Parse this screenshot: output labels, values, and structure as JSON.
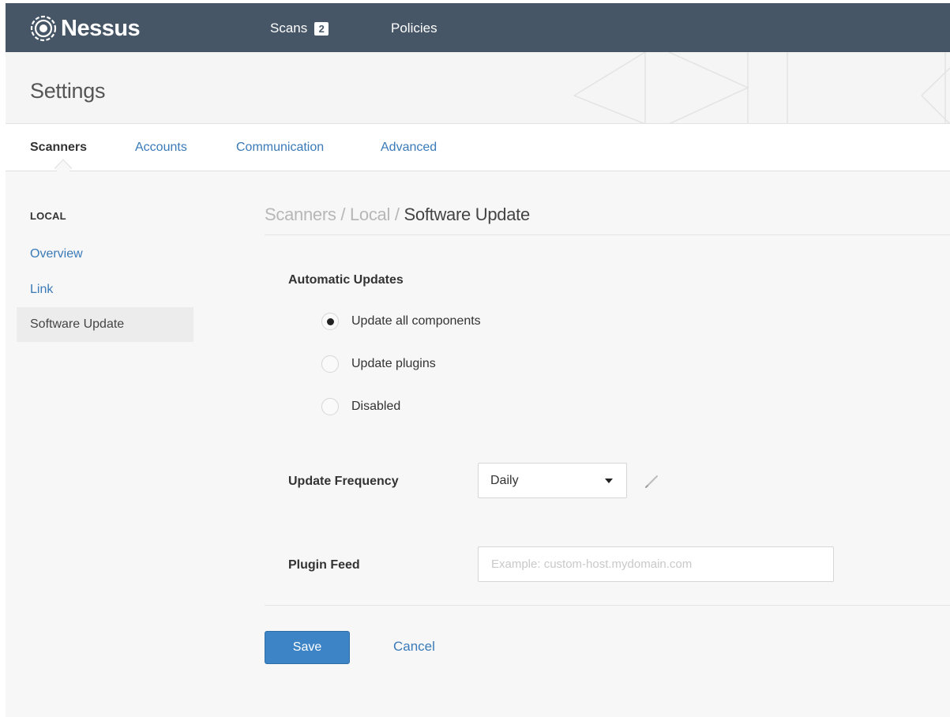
{
  "app": {
    "name": "Nessus",
    "logo_icon": "nessus-logo-icon"
  },
  "nav": {
    "scans_label": "Scans",
    "scans_count": "2",
    "policies_label": "Policies"
  },
  "page": {
    "title": "Settings"
  },
  "tabs": [
    {
      "label": "Scanners",
      "active": true
    },
    {
      "label": "Accounts",
      "active": false
    },
    {
      "label": "Communication",
      "active": false
    },
    {
      "label": "Advanced",
      "active": false
    }
  ],
  "sidebar": {
    "heading": "LOCAL",
    "items": [
      {
        "label": "Overview",
        "active": false
      },
      {
        "label": "Link",
        "active": false
      },
      {
        "label": "Software Update",
        "active": true
      }
    ]
  },
  "breadcrumb": {
    "path": "Scanners / Local /",
    "current": "Software Update"
  },
  "form": {
    "automatic_updates_label": "Automatic Updates",
    "options": [
      {
        "label": "Update all components",
        "selected": true
      },
      {
        "label": "Update plugins",
        "selected": false
      },
      {
        "label": "Disabled",
        "selected": false
      }
    ],
    "frequency_label": "Update Frequency",
    "frequency_value": "Daily",
    "plugin_feed_label": "Plugin Feed",
    "plugin_feed_value": "",
    "plugin_feed_placeholder": "Example: custom-host.mydomain.com",
    "edit_icon": "pencil-icon"
  },
  "actions": {
    "save_label": "Save",
    "cancel_label": "Cancel"
  },
  "colors": {
    "topbar": "#465666",
    "link": "#3a7ab8",
    "primary_button": "#3d84c7"
  }
}
